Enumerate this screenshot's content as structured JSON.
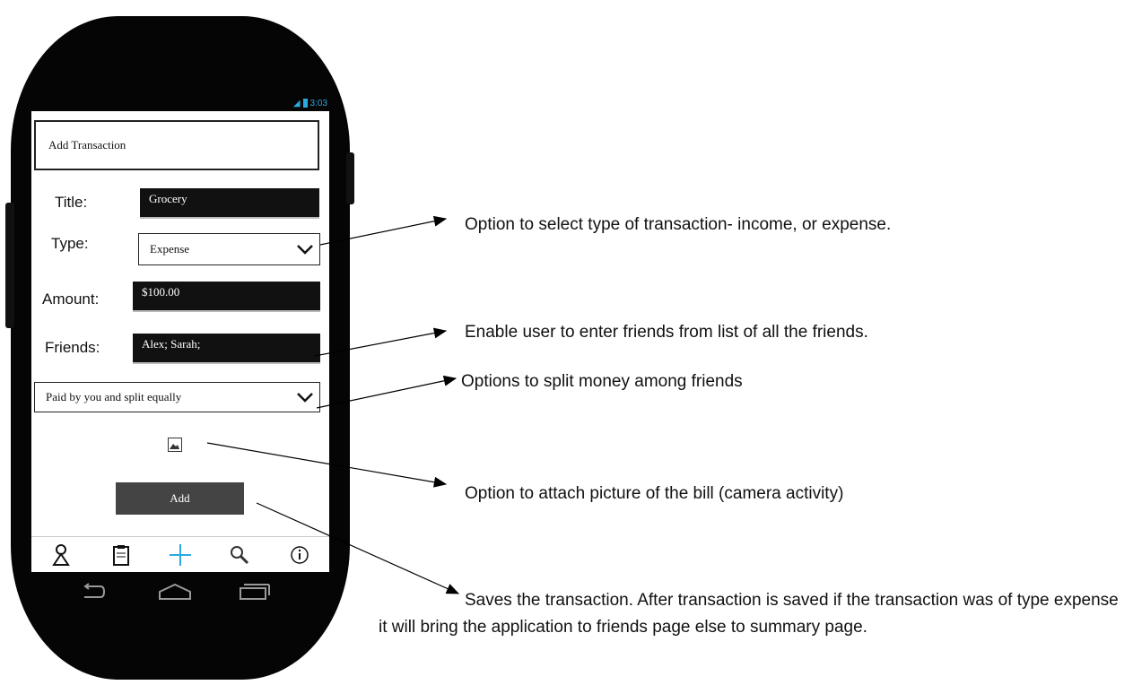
{
  "status_bar": {
    "time": "3:03",
    "signal_icon": "signal-icon",
    "battery_icon": "battery-icon"
  },
  "screen": {
    "header": "Add Transaction",
    "fields": {
      "title_label": "Title:",
      "title_value": "Grocery",
      "type_label": "Type:",
      "type_value": "Expense",
      "amount_label": "Amount:",
      "amount_value": "$100.00",
      "friends_label": "Friends:",
      "friends_value": "Alex; Sarah;"
    },
    "split_option": "Paid by you and split equally",
    "attach_icon": "image-icon",
    "add_button": "Add",
    "tabs": [
      "hourglass-icon",
      "clipboard-icon",
      "plus-icon",
      "search-icon",
      "info-icon"
    ]
  },
  "nav": [
    "back-icon",
    "home-icon",
    "recents-icon"
  ],
  "annotations": {
    "type": "Option to select type of transaction- income, or expense.",
    "friends": "Enable user to enter friends from list of all the friends.",
    "split": "Options to split money among friends",
    "attach": "Option to attach picture of the bill (camera activity)",
    "save": "Saves the transaction. After transaction is saved if the transaction was of type expense it will bring the application to friends page else to summary page."
  },
  "colors": {
    "accent": "#2aa8e0",
    "phone": "#050505",
    "button": "#444444"
  }
}
